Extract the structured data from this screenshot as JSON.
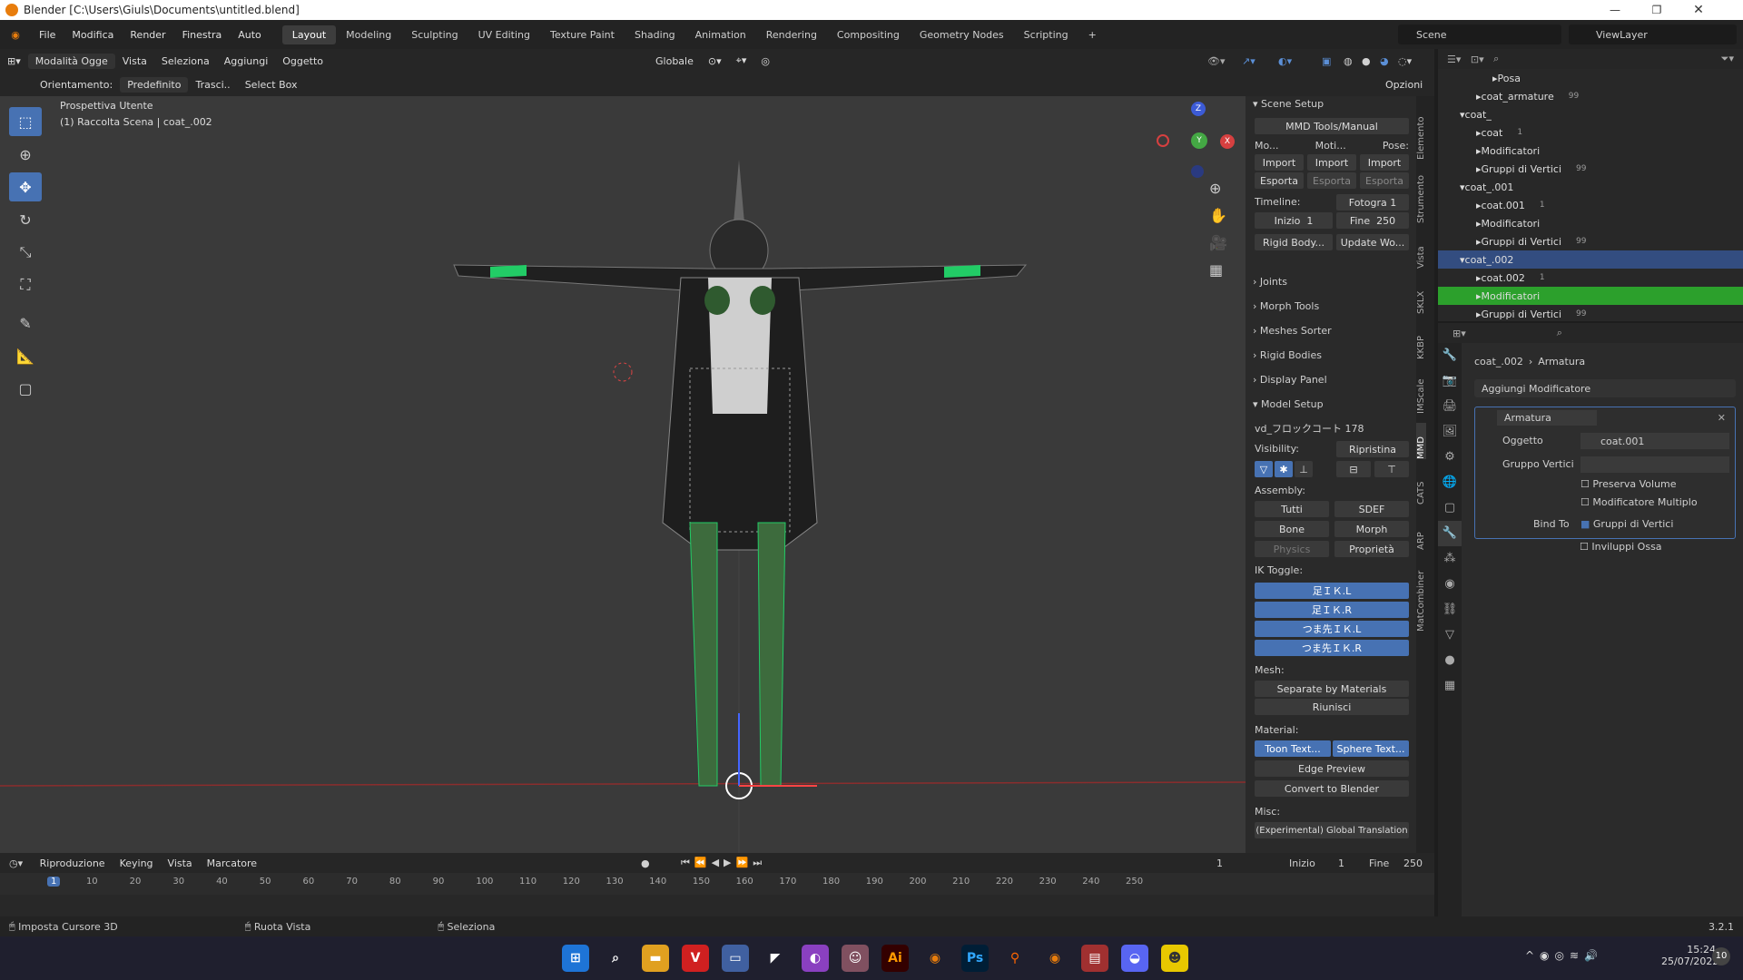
{
  "window": {
    "title": "Blender [C:\\Users\\Giuls\\Documents\\untitled.blend]"
  },
  "menu": [
    "File",
    "Modifica",
    "Render",
    "Finestra",
    "Auto"
  ],
  "workspaces": [
    "Layout",
    "Modeling",
    "Sculpting",
    "UV Editing",
    "Texture Paint",
    "Shading",
    "Animation",
    "Rendering",
    "Compositing",
    "Geometry Nodes",
    "Scripting",
    "+"
  ],
  "scene": {
    "scene_label": "Scene",
    "viewlayer_label": "ViewLayer"
  },
  "header": {
    "mode": "Modalità Ogge",
    "vista": "Vista",
    "seleziona": "Seleziona",
    "aggiungi": "Aggiungi",
    "oggetto": "Oggetto",
    "transform": "Globale"
  },
  "header2": {
    "orient_label": "Orientamento:",
    "orient_value": "Predefinito",
    "trasci": "Trasci..",
    "select_box": "Select Box",
    "opzioni": "Opzioni"
  },
  "viewport": {
    "view_name": "Prospettiva Utente",
    "collection": "(1) Raccolta Scena | coat_.002"
  },
  "npanel": {
    "scene_setup": "Scene Setup",
    "mmd_manual": "MMD Tools/Manual",
    "mo": "Mo...",
    "moti": "Moti...",
    "pose": "Pose:",
    "import": "Import",
    "esporta": "Esporta",
    "timeline_label": "Timeline:",
    "fotogra": "Fotogra",
    "fotogra_val": "1",
    "inizio": "Inizio",
    "inizio_val": "1",
    "fine": "Fine",
    "fine_val": "250",
    "rigid_body": "Rigid Body...",
    "update_wo": "Update Wo...",
    "joints": "Joints",
    "morph_tools": "Morph Tools",
    "meshes_sorter": "Meshes Sorter",
    "rigid_bodies": "Rigid Bodies",
    "display_panel": "Display Panel",
    "model_setup": "Model Setup",
    "model_name": "vd_フロックコート 178",
    "visibility": "Visibility:",
    "ripristina": "Ripristina",
    "assembly": "Assembly:",
    "tutti": "Tutti",
    "sdef": "SDEF",
    "bone": "Bone",
    "morph": "Morph",
    "physics": "Physics",
    "proprieta": "Proprietà",
    "ik_toggle": "IK Toggle:",
    "ik": [
      "足ＩＫ.L",
      "足ＩＫ.R",
      "つま先ＩＫ.L",
      "つま先ＩＫ.R"
    ],
    "mesh": "Mesh:",
    "separate": "Separate by Materials",
    "riunisci": "Riunisci",
    "material": "Material:",
    "toon": "Toon Text...",
    "sphere": "Sphere Text...",
    "edge_preview": "Edge Preview",
    "convert": "Convert to Blender",
    "misc": "Misc:",
    "global_translation": "(Experimental) Global Translation"
  },
  "vtabs": [
    "Elemento",
    "Strumento",
    "Vista",
    "SKLX",
    "KKBP",
    "IMScale",
    "MMD",
    "CATS",
    "ARP",
    "MatCombiner"
  ],
  "outliner": [
    {
      "label": "Posa",
      "indent": 3
    },
    {
      "label": "coat_armature",
      "indent": 2,
      "extra": "99"
    },
    {
      "label": "coat_",
      "indent": 1
    },
    {
      "label": "coat",
      "indent": 2,
      "extra": "1"
    },
    {
      "label": "Modificatori",
      "indent": 2
    },
    {
      "label": "Gruppi di Vertici",
      "indent": 2,
      "extra": "99"
    },
    {
      "label": "coat_.001",
      "indent": 1
    },
    {
      "label": "coat.001",
      "indent": 2,
      "extra": "1"
    },
    {
      "label": "Modificatori",
      "indent": 2
    },
    {
      "label": "Gruppi di Vertici",
      "indent": 2,
      "extra": "99"
    },
    {
      "label": "coat_.002",
      "indent": 1,
      "selected": "blue"
    },
    {
      "label": "coat.002",
      "indent": 2,
      "extra": "1"
    },
    {
      "label": "Modificatori",
      "indent": 2,
      "selected": "green"
    },
    {
      "label": "Gruppi di Vertici",
      "indent": 2,
      "extra": "99"
    }
  ],
  "properties": {
    "breadcrumb_obj": "coat_.002",
    "breadcrumb_mod": "Armatura",
    "add_modifier": "Aggiungi Modificatore",
    "mod_name": "Armatura",
    "oggetto_label": "Oggetto",
    "oggetto_val": "coat.001",
    "gruppo_label": "Gruppo Vertici",
    "preserva": "Preserva Volume",
    "multiplo": "Modificatore Multiplo",
    "bind_to": "Bind To",
    "gruppi": "Gruppi di Vertici",
    "inviluppi": "Inviluppi Ossa"
  },
  "timeline": {
    "riproduzione": "Riproduzione",
    "keying": "Keying",
    "vista": "Vista",
    "marcatore": "Marcatore",
    "current": "1",
    "inizio": "Inizio",
    "inizio_val": "1",
    "fine": "Fine",
    "fine_val": "250",
    "ticks": [
      "1",
      "10",
      "20",
      "30",
      "40",
      "50",
      "60",
      "70",
      "80",
      "90",
      "100",
      "110",
      "120",
      "130",
      "140",
      "150",
      "160",
      "170",
      "180",
      "190",
      "200",
      "210",
      "220",
      "230",
      "240",
      "250"
    ]
  },
  "status": {
    "a": "Imposta Cursore 3D",
    "b": "Ruota Vista",
    "c": "Seleziona",
    "version": "3.2.1"
  },
  "taskbar": {
    "time": "15:24",
    "date": "25/07/2022",
    "badge": "10"
  }
}
